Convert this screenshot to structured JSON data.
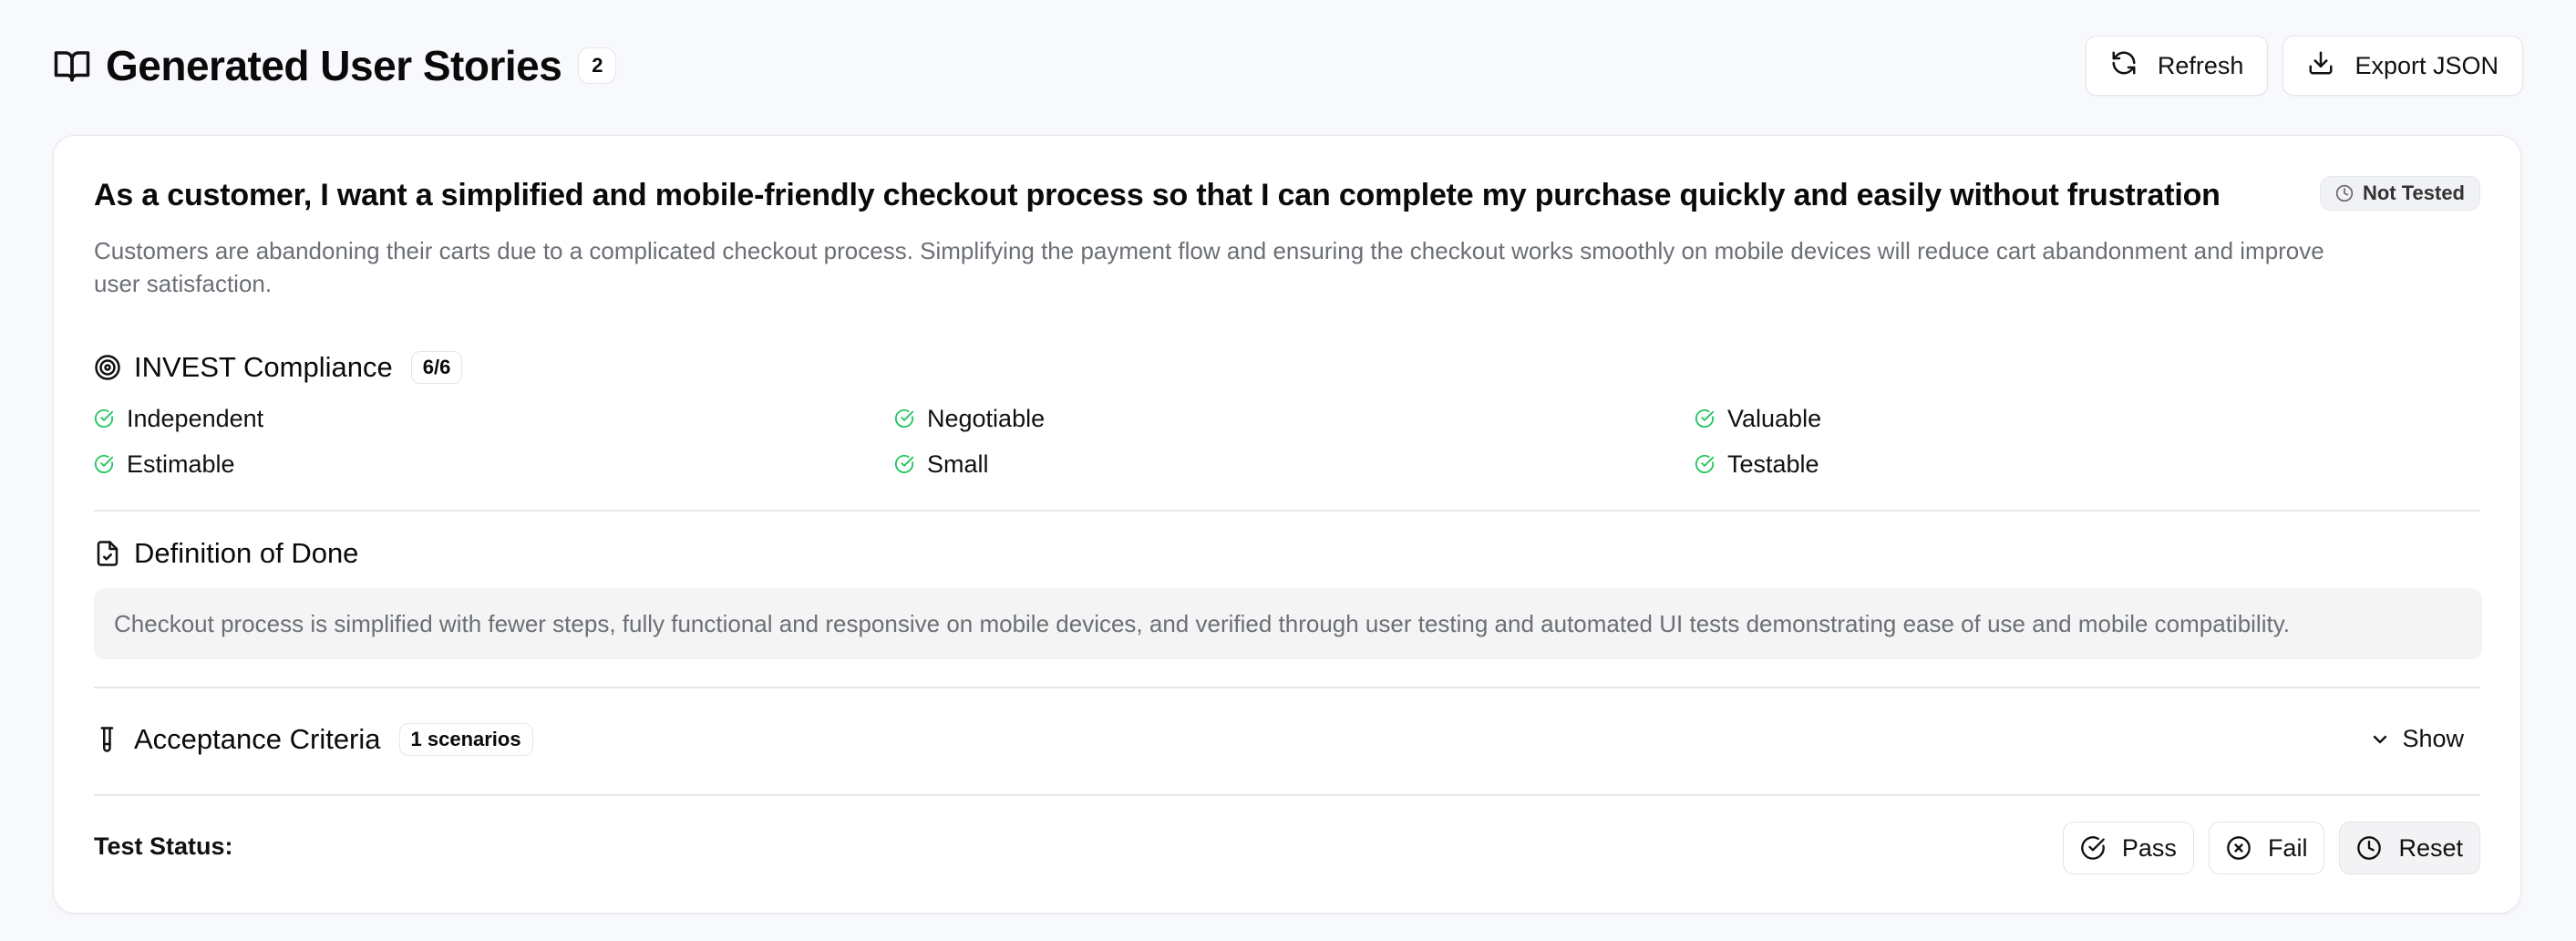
{
  "header": {
    "title": "Generated User Stories",
    "count": "2",
    "refresh_label": "Refresh",
    "export_label": "Export JSON"
  },
  "story": {
    "title": "As a customer, I want a simplified and mobile-friendly checkout process so that I can complete my purchase quickly and easily without frustration",
    "status": "Not Tested",
    "description": "Customers are abandoning their carts due to a complicated checkout process. Simplifying the payment flow and ensuring the checkout works smoothly on mobile devices will reduce cart abandonment and improve user satisfaction.",
    "invest": {
      "title": "INVEST Compliance",
      "score": "6/6",
      "items": [
        "Independent",
        "Negotiable",
        "Valuable",
        "Estimable",
        "Small",
        "Testable"
      ]
    },
    "dod": {
      "title": "Definition of Done",
      "text": "Checkout process is simplified with fewer steps, fully functional and responsive on mobile devices, and verified through user testing and automated UI tests demonstrating ease of use and mobile compatibility."
    },
    "acceptance": {
      "title": "Acceptance Criteria",
      "badge": "1 scenarios",
      "toggle": "Show"
    },
    "test": {
      "label": "Test Status:",
      "pass": "Pass",
      "fail": "Fail",
      "reset": "Reset"
    }
  },
  "colors": {
    "check": "#22c55e",
    "accent": "#0a0a0a"
  }
}
